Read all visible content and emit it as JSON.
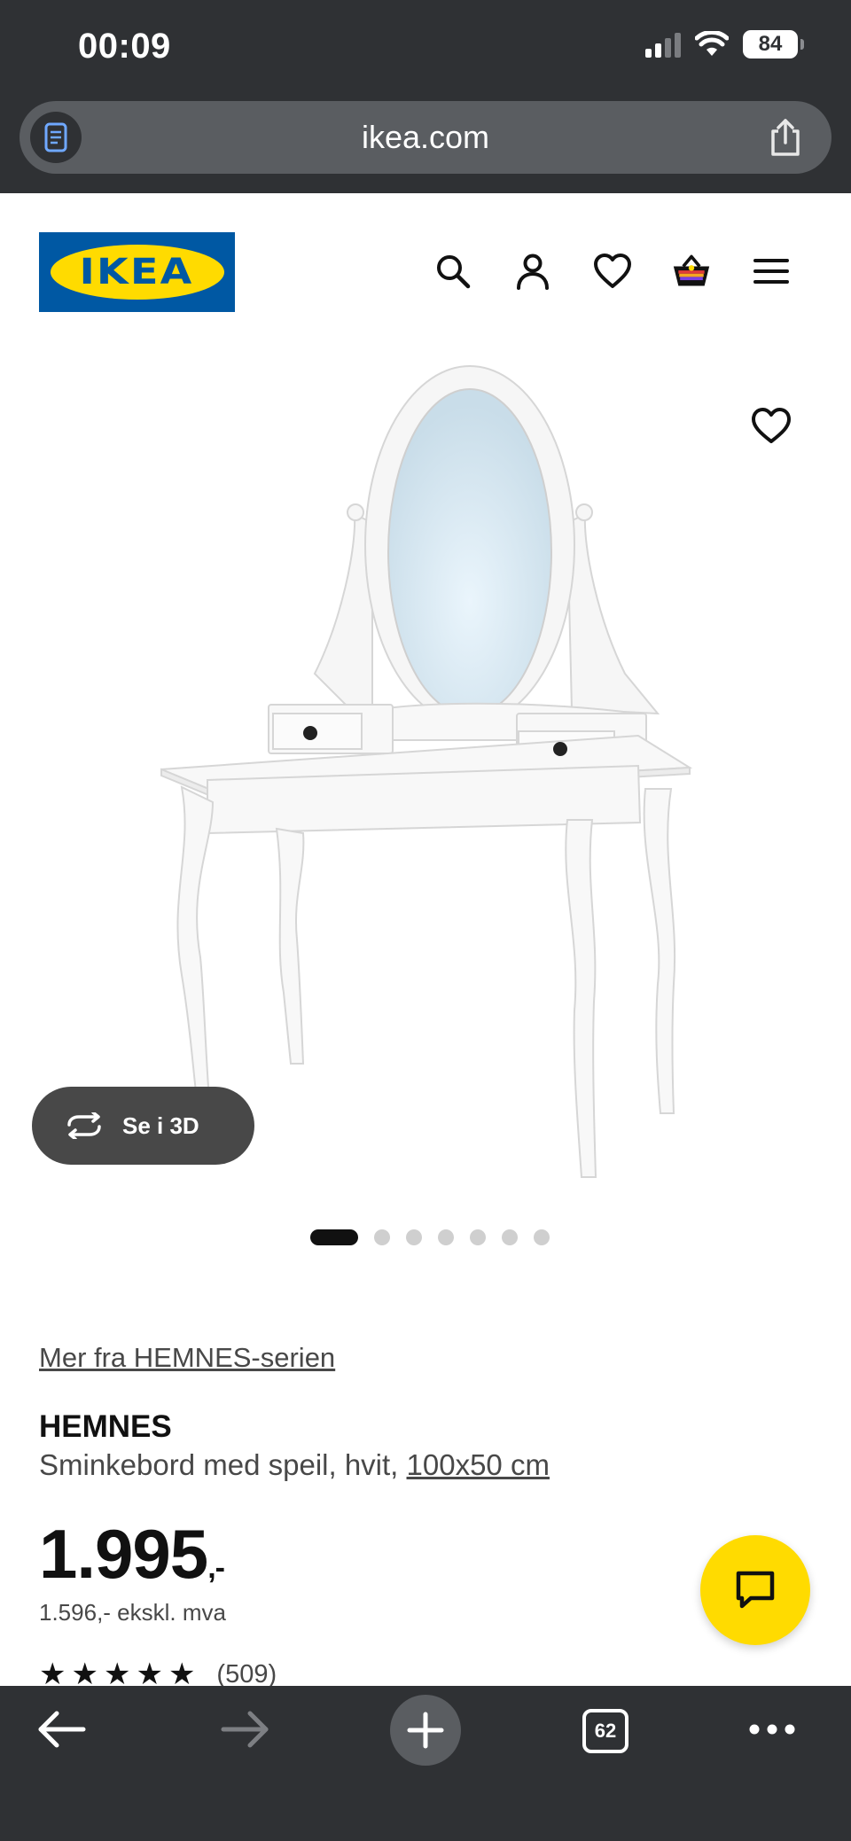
{
  "status_bar": {
    "time": "00:09",
    "battery": "84"
  },
  "browser": {
    "url": "ikea.com"
  },
  "header": {
    "logo_text": "IKEA",
    "brand_colors": {
      "blue": "#0058a3",
      "yellow": "#ffdb00"
    },
    "icons": [
      "search-icon",
      "account-icon",
      "wishlist-heart-icon",
      "shopping-bag-icon",
      "menu-icon"
    ]
  },
  "gallery": {
    "view_3d_label": "Se i 3D",
    "image_count": 7,
    "active_index": 0
  },
  "product": {
    "series_link": "Mer fra HEMNES-serien",
    "name": "HEMNES",
    "description_prefix": "Sminkebord med speil, hvit, ",
    "size_link": "100x50 cm",
    "price_main": "1.995",
    "price_suffix": ",-",
    "price_ex_vat": "1.596,- ekskl. mva",
    "rating_stars": 5,
    "rating_count": "(509)"
  },
  "toolbar": {
    "tab_count": "62",
    "icons": [
      "back-arrow-icon",
      "forward-arrow-icon",
      "new-tab-plus-icon",
      "tabs-icon",
      "more-icon"
    ]
  }
}
